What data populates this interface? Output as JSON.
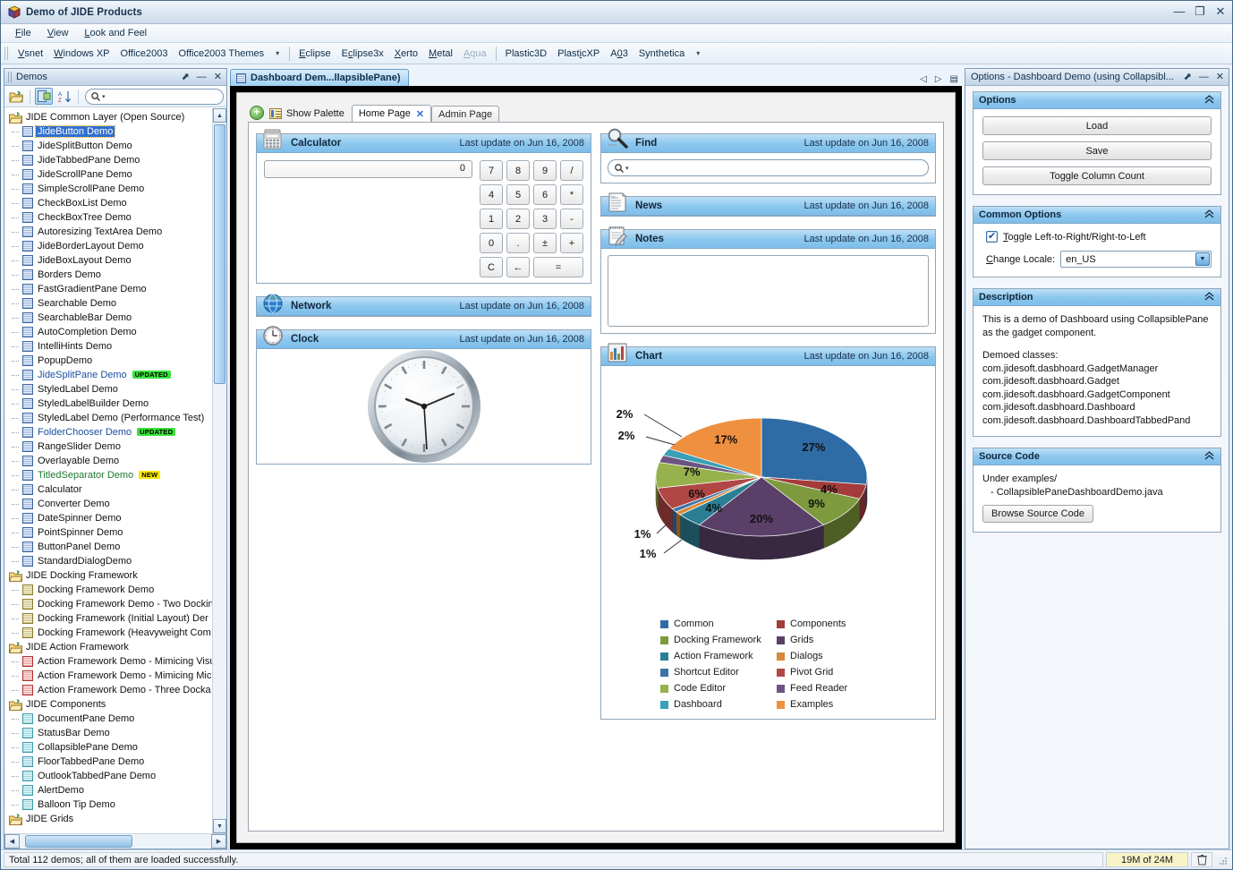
{
  "window": {
    "title": "Demo of JIDE Products",
    "icon": "jide-cube-icon",
    "minimize": "—",
    "maximize": "❐",
    "close": "✕"
  },
  "menubar": {
    "items": [
      "File",
      "View",
      "Look and Feel"
    ]
  },
  "lnf_toolbar": {
    "items": [
      {
        "label": "Vsnet",
        "disabled": false
      },
      {
        "label": "Windows XP",
        "disabled": false
      },
      {
        "label": "Office2003",
        "disabled": false
      },
      {
        "label": "Office2003 Themes",
        "disabled": false
      },
      {
        "label": "Eclipse",
        "disabled": false
      },
      {
        "label": "Eclipse3x",
        "disabled": false
      },
      {
        "label": "Xerto",
        "disabled": false
      },
      {
        "label": "Metal",
        "disabled": false
      },
      {
        "label": "Aqua",
        "disabled": true
      },
      {
        "label": "Plastic3D",
        "disabled": false
      },
      {
        "label": "PlasticXP",
        "disabled": false
      },
      {
        "label": "A03",
        "disabled": false
      },
      {
        "label": "Synthetica",
        "disabled": false
      }
    ],
    "overflow_arrow": "▾"
  },
  "demos_pane": {
    "title": "Demos",
    "float_btn": "⬈",
    "minimize_btn": "—",
    "close_btn": "✕",
    "toolbar": {
      "open_icon": "open-folder-icon",
      "expand_icon": "expand-tree-icon",
      "sort_icon": "sort-az-icon"
    },
    "search_placeholder": "",
    "tree": [
      {
        "label": "JIDE Common Layer (Open Source)",
        "type": "folder"
      },
      {
        "label": "JideButton Demo",
        "type": "leaf",
        "icon": "blue",
        "selected": true
      },
      {
        "label": "JideSplitButton Demo",
        "type": "leaf",
        "icon": "blue"
      },
      {
        "label": "JideTabbedPane Demo",
        "type": "leaf",
        "icon": "blue"
      },
      {
        "label": "JideScrollPane Demo",
        "type": "leaf",
        "icon": "blue"
      },
      {
        "label": "SimpleScrollPane Demo",
        "type": "leaf",
        "icon": "blue"
      },
      {
        "label": "CheckBoxList Demo",
        "type": "leaf",
        "icon": "blue"
      },
      {
        "label": "CheckBoxTree Demo",
        "type": "leaf",
        "icon": "blue"
      },
      {
        "label": "Autoresizing TextArea Demo",
        "type": "leaf",
        "icon": "blue"
      },
      {
        "label": "JideBorderLayout Demo",
        "type": "leaf",
        "icon": "blue"
      },
      {
        "label": "JideBoxLayout Demo",
        "type": "leaf",
        "icon": "blue"
      },
      {
        "label": "Borders Demo",
        "type": "leaf",
        "icon": "blue"
      },
      {
        "label": "FastGradientPane Demo",
        "type": "leaf",
        "icon": "blue"
      },
      {
        "label": "Searchable Demo",
        "type": "leaf",
        "icon": "blue"
      },
      {
        "label": "SearchableBar Demo",
        "type": "leaf",
        "icon": "blue"
      },
      {
        "label": "AutoCompletion Demo",
        "type": "leaf",
        "icon": "blue"
      },
      {
        "label": "IntelliHints Demo",
        "type": "leaf",
        "icon": "blue"
      },
      {
        "label": "PopupDemo",
        "type": "leaf",
        "icon": "blue"
      },
      {
        "label": "JideSplitPane Demo",
        "type": "leaf",
        "icon": "blue",
        "color": "blue",
        "badge": "UPDATED"
      },
      {
        "label": "StyledLabel Demo",
        "type": "leaf",
        "icon": "blue"
      },
      {
        "label": "StyledLabelBuilder Demo",
        "type": "leaf",
        "icon": "blue"
      },
      {
        "label": "StyledLabel Demo (Performance Test)",
        "type": "leaf",
        "icon": "blue"
      },
      {
        "label": "FolderChooser Demo",
        "type": "leaf",
        "icon": "blue",
        "color": "blue",
        "badge": "UPDATED"
      },
      {
        "label": "RangeSlider Demo",
        "type": "leaf",
        "icon": "blue"
      },
      {
        "label": "Overlayable Demo",
        "type": "leaf",
        "icon": "blue"
      },
      {
        "label": "TitledSeparator Demo",
        "type": "leaf",
        "icon": "blue",
        "color": "green",
        "badge": "NEW"
      },
      {
        "label": "Calculator",
        "type": "leaf",
        "icon": "blue"
      },
      {
        "label": "Converter Demo",
        "type": "leaf",
        "icon": "blue"
      },
      {
        "label": "DateSpinner Demo",
        "type": "leaf",
        "icon": "blue"
      },
      {
        "label": "PointSpinner Demo",
        "type": "leaf",
        "icon": "blue"
      },
      {
        "label": "ButtonPanel Demo",
        "type": "leaf",
        "icon": "blue"
      },
      {
        "label": "StandardDialogDemo",
        "type": "leaf",
        "icon": "blue"
      },
      {
        "label": "JIDE Docking Framework",
        "type": "folder"
      },
      {
        "label": "Docking Framework Demo",
        "type": "leaf",
        "icon": "olive"
      },
      {
        "label": "Docking Framework Demo - Two Dockin",
        "type": "leaf",
        "icon": "olive"
      },
      {
        "label": "Docking Framework (Initial Layout) Der",
        "type": "leaf",
        "icon": "olive"
      },
      {
        "label": "Docking Framework (Heavyweight Com",
        "type": "leaf",
        "icon": "olive"
      },
      {
        "label": "JIDE Action Framework",
        "type": "folder"
      },
      {
        "label": "Action Framework Demo - Mimicing Visu",
        "type": "leaf",
        "icon": "red"
      },
      {
        "label": "Action Framework Demo - Mimicing Micr",
        "type": "leaf",
        "icon": "red"
      },
      {
        "label": "Action Framework Demo - Three Docka",
        "type": "leaf",
        "icon": "red"
      },
      {
        "label": "JIDE Components",
        "type": "folder"
      },
      {
        "label": "DocumentPane Demo",
        "type": "leaf",
        "icon": "cyan"
      },
      {
        "label": "StatusBar Demo",
        "type": "leaf",
        "icon": "cyan"
      },
      {
        "label": "CollapsiblePane Demo",
        "type": "leaf",
        "icon": "cyan"
      },
      {
        "label": "FloorTabbedPane Demo",
        "type": "leaf",
        "icon": "cyan"
      },
      {
        "label": "OutlookTabbedPane Demo",
        "type": "leaf",
        "icon": "cyan"
      },
      {
        "label": "AlertDemo",
        "type": "leaf",
        "icon": "cyan"
      },
      {
        "label": "Balloon Tip Demo",
        "type": "leaf",
        "icon": "cyan"
      },
      {
        "label": "JIDE Grids",
        "type": "folder"
      }
    ]
  },
  "document": {
    "tab_label": "Dashboard Dem...llapsiblePane)",
    "nav_prev": "◁",
    "nav_next": "▷",
    "nav_list": "▤"
  },
  "dashboard": {
    "add_icon": "add-gadget-icon",
    "show_palette_label": "Show Palette",
    "tabs": [
      {
        "label": "Home Page",
        "active": true,
        "closable": true,
        "close": "✕"
      },
      {
        "label": "Admin Page",
        "active": false,
        "closable": false
      }
    ],
    "last_update": "Last update on Jun 16, 2008",
    "gadgets": {
      "calculator": {
        "title": "Calculator",
        "icon": "calculator-icon",
        "display_value": "0",
        "keys": [
          "7",
          "8",
          "9",
          "/",
          "4",
          "5",
          "6",
          "*",
          "1",
          "2",
          "3",
          "-",
          "0",
          ".",
          "±",
          "+",
          "C",
          "←",
          "="
        ]
      },
      "network": {
        "title": "Network",
        "icon": "globe-icon"
      },
      "clock": {
        "title": "Clock",
        "icon": "clock-icon"
      },
      "find": {
        "title": "Find",
        "icon": "magnifier-icon",
        "search_placeholder": ""
      },
      "news": {
        "title": "News",
        "icon": "newspaper-icon"
      },
      "notes": {
        "title": "Notes",
        "icon": "notepad-icon",
        "text": ""
      },
      "chart": {
        "title": "Chart",
        "icon": "bar-chart-icon"
      }
    }
  },
  "chart_data": {
    "type": "pie",
    "title": "Chart",
    "labels": [
      "Common",
      "Components",
      "Docking Framework",
      "Grids",
      "Action Framework",
      "Dialogs",
      "Shortcut Editor",
      "Pivot Grid",
      "Code Editor",
      "Feed Reader",
      "Dashboard",
      "Examples"
    ],
    "values": [
      27,
      4,
      9,
      20,
      4,
      1,
      1,
      6,
      7,
      2,
      2,
      17
    ],
    "value_labels": [
      "27%",
      "4%",
      "9%",
      "20%",
      "4%",
      "1%",
      "1%",
      "6%",
      "7%",
      "2%",
      "2%",
      "17%"
    ],
    "colors": [
      "#2f6ca5",
      "#a33c3a",
      "#7d9a3e",
      "#5a4069",
      "#2b7f95",
      "#d78a3b",
      "#3d74a8",
      "#b04744",
      "#97b14c",
      "#6c5583",
      "#3aa0b5",
      "#ef9040"
    ],
    "legend_position": "bottom",
    "legend_columns": 2,
    "three_d": true
  },
  "options_pane": {
    "title": "Options - Dashboard Demo (using Collapsibl...",
    "float_btn": "⬈",
    "minimize_btn": "—",
    "close_btn": "✕",
    "options": {
      "header": "Options",
      "collapse_icon": "chevron-up-icon",
      "buttons": [
        "Load",
        "Save",
        "Toggle Column Count"
      ]
    },
    "common_options": {
      "header": "Common Options",
      "collapse_icon": "chevron-up-icon",
      "checkbox_label": "Toggle Left-to-Right/Right-to-Left",
      "checkbox_checked": true,
      "locale_label": "Change Locale:",
      "locale_value": "en_US",
      "locale_arrow": "▼"
    },
    "description": {
      "header": "Description",
      "collapse_icon": "chevron-up-icon",
      "lines": [
        "This is a demo of Dashboard using CollapsiblePane",
        "as the gadget component.",
        "",
        "Demoed classes:",
        "com.jidesoft.dasbhoard.GadgetManager",
        "com.jidesoft.dasbhoard.Gadget",
        "com.jidesoft.dasbhoard.GadgetComponent",
        "com.jidesoft.dasbhoard.Dashboard",
        "com.jidesoft.dasbhoard.DashboardTabbedPand"
      ]
    },
    "source_code": {
      "header": "Source Code",
      "collapse_icon": "chevron-up-icon",
      "line1": "Under examples/",
      "line2": "- CollapsiblePaneDashboardDemo.java",
      "button": "Browse Source Code"
    }
  },
  "statusbar": {
    "message": "Total 112 demos; all of them are loaded successfully.",
    "memory": "19M of 24M",
    "trash_icon": "trash-icon"
  }
}
